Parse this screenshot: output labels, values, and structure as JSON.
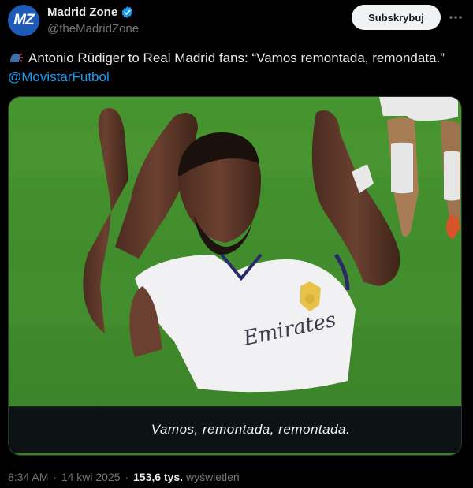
{
  "account": {
    "avatar_text": "MZ",
    "display_name": "Madrid Zone",
    "handle": "@theMadridZone",
    "verified": true,
    "avatar_color": "#1e5bb8"
  },
  "actions": {
    "subscribe_label": "Subskrybuj",
    "more_icon": "more-icon"
  },
  "tweet": {
    "icon": "speaking-head-icon",
    "text": "Antonio Rüdiger to Real Madrid fans: “Vamos remontada, remondata.”",
    "mention": "@MovistarFutbol"
  },
  "media": {
    "subtitle": "Vamos, remontada, remontada.",
    "shirt_text": "Emirates"
  },
  "meta": {
    "time": "8:34 AM",
    "date": "14 kwi 2025",
    "views_count": "153,6 tys.",
    "views_label": "wyświetleń"
  },
  "colors": {
    "background": "#000000",
    "accent": "#1d9bf0",
    "text": "#e7e9ea",
    "muted": "#71767b",
    "pitch": "#3f8a2e"
  }
}
